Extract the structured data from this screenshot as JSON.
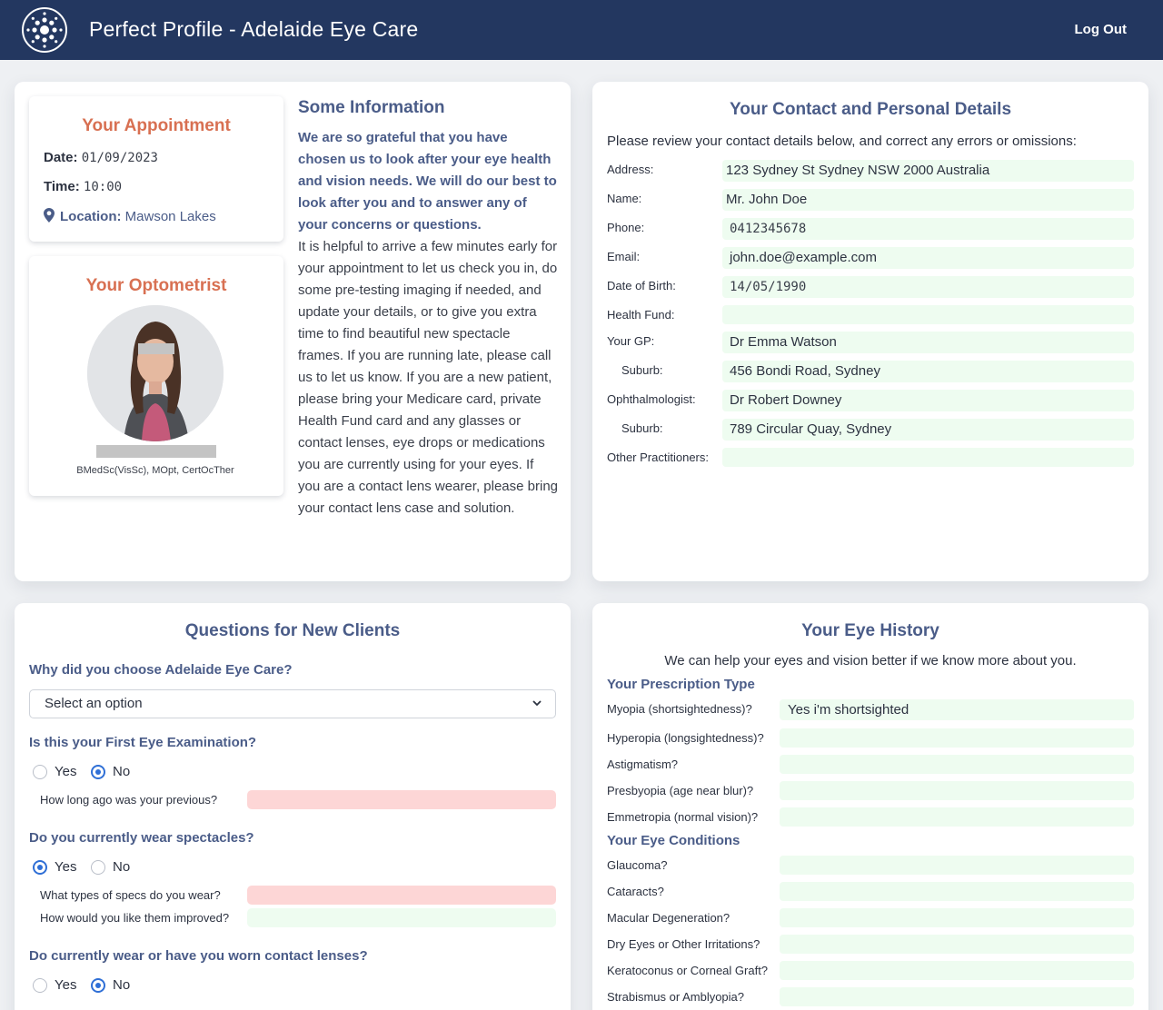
{
  "header": {
    "title": "Perfect Profile - Adelaide Eye Care",
    "logout_label": "Log Out"
  },
  "appointment": {
    "title": "Your Appointment",
    "date_label": "Date:",
    "date": "01/09/2023",
    "time_label": "Time:",
    "time": "10:00",
    "location_label": "Location:",
    "location": "Mawson Lakes"
  },
  "optometrist": {
    "title": "Your Optometrist",
    "qualifications": "BMedSc(VisSc), MOpt, CertOcTher"
  },
  "information": {
    "title": "Some Information",
    "bold_text": "We are so grateful that you have chosen us to look after your eye health and vision needs. We will do our best to look after you and to answer any of your concerns or questions.",
    "body_text": "It is helpful to arrive a few minutes early for your appointment to let us check you in, do some pre-testing imaging if needed, and update your details, or to give you extra time to find beautiful new spectacle frames. If you are running late, please call us to let us know. If you are a new patient, please bring your Medicare card, private Health Fund card and any glasses or contact lenses, eye drops or medications you are currently using for your eyes. If you are a contact lens wearer, please bring your contact lens case and solution."
  },
  "contact": {
    "title": "Your Contact and Personal Details",
    "intro": "Please review your contact details below, and correct any errors or omissions:",
    "fields": [
      {
        "label": "Address:",
        "value": "123 Sydney St Sydney NSW 2000 Australia"
      },
      {
        "label": "Name:",
        "value": "Mr. John Doe"
      },
      {
        "label": "Phone:",
        "value": "0412345678"
      },
      {
        "label": "Email:",
        "value": "john.doe@example.com"
      },
      {
        "label": "Date of Birth:",
        "value": "14/05/1990"
      },
      {
        "label": "Health Fund:",
        "value": ""
      },
      {
        "label": "Your GP:",
        "value": "Dr Emma Watson"
      },
      {
        "label": "Suburb:",
        "value": "456 Bondi Road, Sydney"
      },
      {
        "label": "Ophthalmologist:",
        "value": "Dr Robert Downey"
      },
      {
        "label": "Suburb:",
        "value": "789 Circular Quay, Sydney"
      },
      {
        "label": "Other Practitioners:",
        "value": ""
      }
    ]
  },
  "questions": {
    "title": "Questions for New Clients",
    "q1": {
      "label": "Why did you choose Adelaide Eye Care?",
      "select_value": "Select an option"
    },
    "q2": {
      "label": "Is this your First Eye Examination?",
      "yes": "Yes",
      "no": "No",
      "selected": "No",
      "sub_label": "How long ago was your previous?"
    },
    "q3": {
      "label": "Do you currently wear spectacles?",
      "yes": "Yes",
      "no": "No",
      "selected": "Yes",
      "sub1_label": "What types of specs do you wear?",
      "sub2_label": "How would you like them improved?"
    },
    "q4": {
      "label": "Do currently wear or have you worn contact lenses?",
      "yes": "Yes",
      "no": "No",
      "selected": "No"
    }
  },
  "eye_history": {
    "title": "Your Eye History",
    "intro": "We can help your eyes and vision better if we know more about you.",
    "prescription_title": "Your Prescription Type",
    "prescription": [
      {
        "label": "Myopia (shortsightedness)?",
        "value": "Yes i'm shortsighted"
      },
      {
        "label": "Hyperopia (longsightedness)?",
        "value": ""
      },
      {
        "label": "Astigmatism?",
        "value": ""
      },
      {
        "label": "Presbyopia (age near blur)?",
        "value": ""
      },
      {
        "label": "Emmetropia (normal vision)?",
        "value": ""
      }
    ],
    "conditions_title": "Your Eye Conditions",
    "conditions": [
      {
        "label": "Glaucoma?",
        "value": ""
      },
      {
        "label": "Cataracts?",
        "value": ""
      },
      {
        "label": "Macular Degeneration?",
        "value": ""
      },
      {
        "label": "Dry Eyes or Other Irritations?",
        "value": ""
      },
      {
        "label": "Keratoconus or Corneal Graft?",
        "value": ""
      },
      {
        "label": "Strabismus or Amblyopia?",
        "value": ""
      }
    ]
  }
}
